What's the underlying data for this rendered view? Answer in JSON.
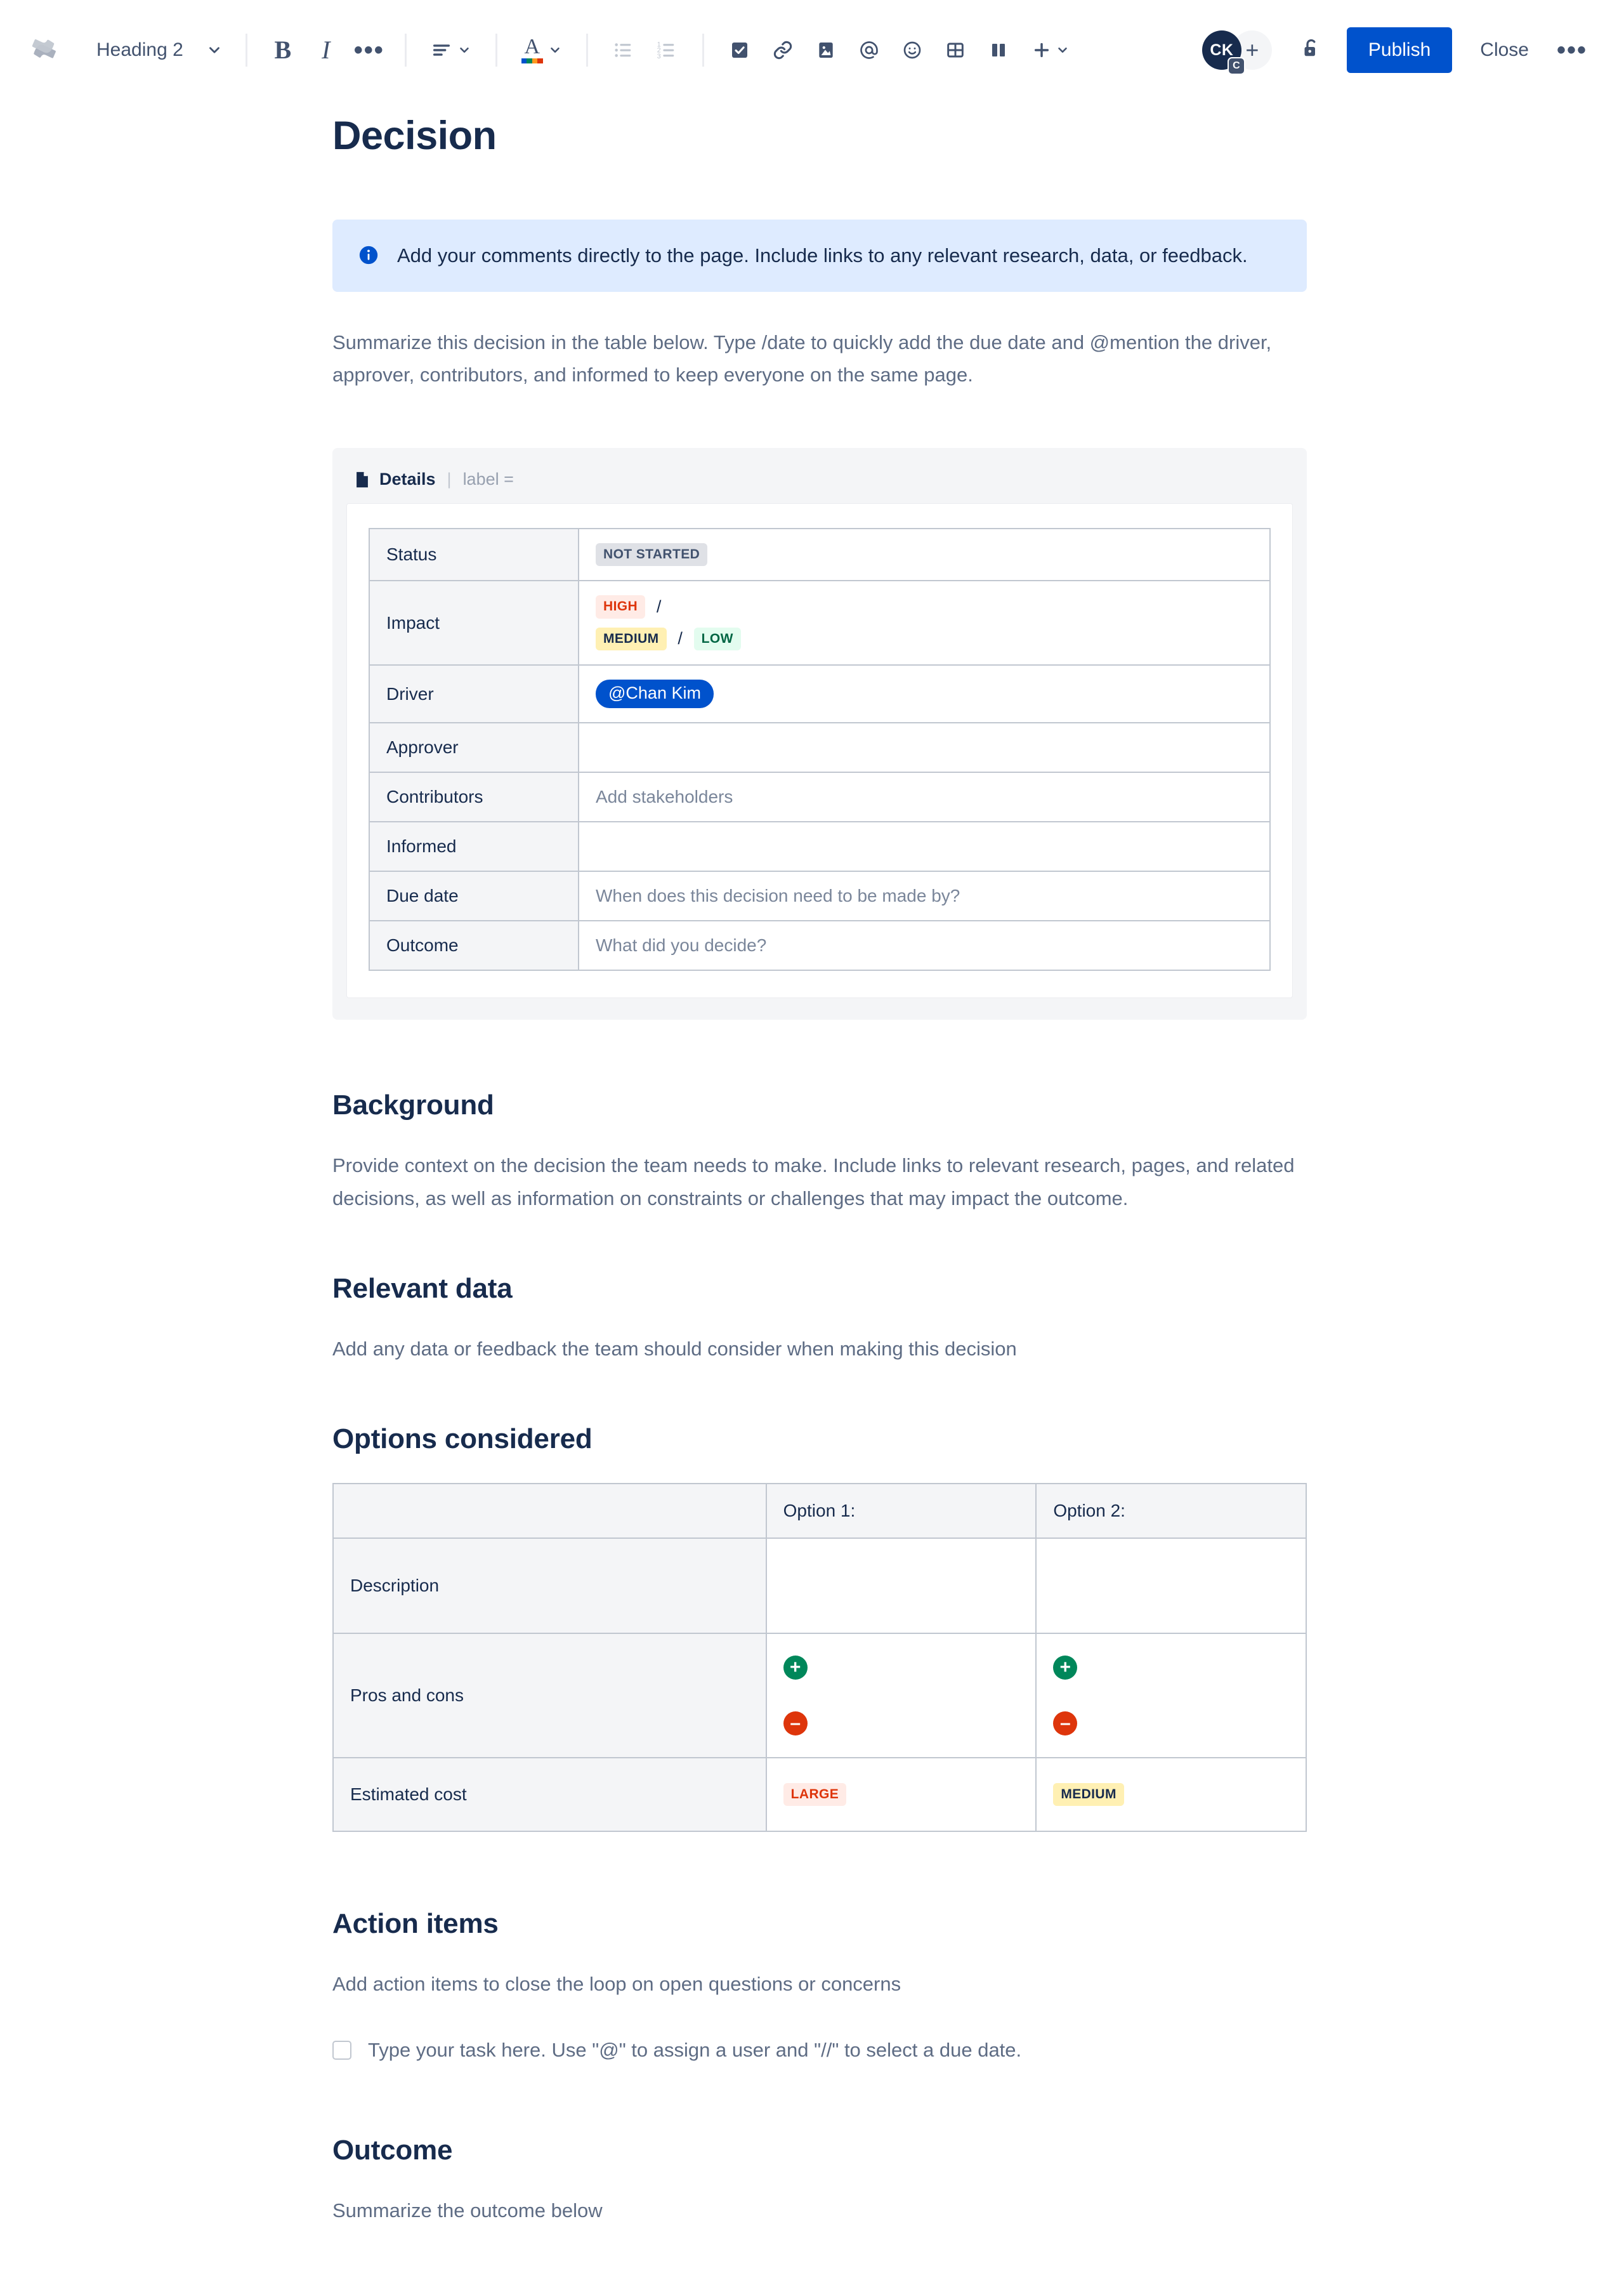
{
  "toolbar": {
    "logo_icon": "confluence-logo-icon",
    "style_select": {
      "value": "Heading 2",
      "chevron_icon": "chevron-down-icon"
    },
    "bold_label": "B",
    "italic_label": "I",
    "more_formatting_label": "•••",
    "align_icon": "text-align-icon",
    "text_color_label": "A",
    "bullet_list_icon": "bullet-list-icon",
    "numbered_list_icon": "numbered-list-icon",
    "task_icon": "checkbox-task-icon",
    "link_icon": "link-icon",
    "image_icon": "image-icon",
    "mention_icon": "mention-at-icon",
    "emoji_icon": "emoji-icon",
    "table_icon": "table-icon",
    "layout_icon": "layout-columns-icon",
    "insert_label": "+",
    "avatar_initials": "CK",
    "avatar_badge": "C",
    "add_people_label": "+",
    "lock_icon": "unlocked-padlock-icon",
    "publish_label": "Publish",
    "close_label": "Close",
    "more_options_label": "•••"
  },
  "document": {
    "title": "Decision",
    "info_panel": {
      "icon": "info-icon",
      "text": "Add your comments directly to the page. Include links to any relevant research, data, or feedback."
    },
    "intro_paragraph": "Summarize this decision in the table below. Type /date to quickly add the due date and @mention the driver, approver, contributors, and informed to keep everyone on the same page.",
    "details_macro": {
      "icon": "page-details-icon",
      "label": "Details",
      "separator": "|",
      "meta": "label =",
      "rows": [
        {
          "key": "Status",
          "type": "lozenge",
          "lozenges": [
            {
              "text": "NOT STARTED",
              "color": "grey"
            }
          ]
        },
        {
          "key": "Impact",
          "type": "lozenge-multi",
          "line1": [
            {
              "text": "HIGH",
              "color": "red"
            }
          ],
          "line1_suffix": "/",
          "line2": [
            {
              "text": "MEDIUM",
              "color": "yellow"
            },
            {
              "text": "LOW",
              "color": "green"
            }
          ],
          "line2_sep": "/"
        },
        {
          "key": "Driver",
          "type": "mention",
          "mention": "@Chan Kim"
        },
        {
          "key": "Approver",
          "type": "empty",
          "value": ""
        },
        {
          "key": "Contributors",
          "type": "placeholder",
          "value": "Add stakeholders"
        },
        {
          "key": "Informed",
          "type": "empty",
          "value": ""
        },
        {
          "key": "Due date",
          "type": "placeholder",
          "value": "When does this decision need to be made by?"
        },
        {
          "key": "Outcome",
          "type": "placeholder",
          "value": "What did you decide?"
        }
      ]
    },
    "sections": {
      "background": {
        "heading": "Background",
        "body": "Provide context on the decision the team needs to make. Include links to relevant research, pages, and related decisions, as well as information on constraints or challenges that may impact the outcome."
      },
      "relevant_data": {
        "heading": "Relevant data",
        "body": "Add any data or feedback the team should consider when making this decision"
      },
      "options_considered": {
        "heading": "Options considered",
        "table": {
          "col_headers": [
            "",
            "Option 1:",
            "Option 2:"
          ],
          "rows": [
            {
              "label": "Description",
              "option1": "",
              "option2": ""
            },
            {
              "label": "Pros and cons",
              "option1_icons": [
                "plus-icon",
                "minus-icon"
              ],
              "option2_icons": [
                "plus-icon",
                "minus-icon"
              ]
            },
            {
              "label": "Estimated cost",
              "option1_lozenge": {
                "text": "LARGE",
                "color": "red"
              },
              "option2_lozenge": {
                "text": "MEDIUM",
                "color": "yellow"
              }
            }
          ]
        }
      },
      "action_items": {
        "heading": "Action items",
        "body": "Add action items to close the loop on open questions or concerns",
        "task_placeholder": "Type your task here. Use \"@\" to assign a user and \"//\" to select a due date.",
        "task_checked": false
      },
      "outcome": {
        "heading": "Outcome",
        "body": "Summarize the outcome below"
      }
    }
  },
  "colors": {
    "brand_blue": "#0052CC",
    "text_primary": "#172B4D",
    "text_subtle": "#5E6C84",
    "panel_info_bg": "#DEEBFF",
    "panel_grey_bg": "#F4F5F7",
    "border": "#C1C7D0"
  }
}
